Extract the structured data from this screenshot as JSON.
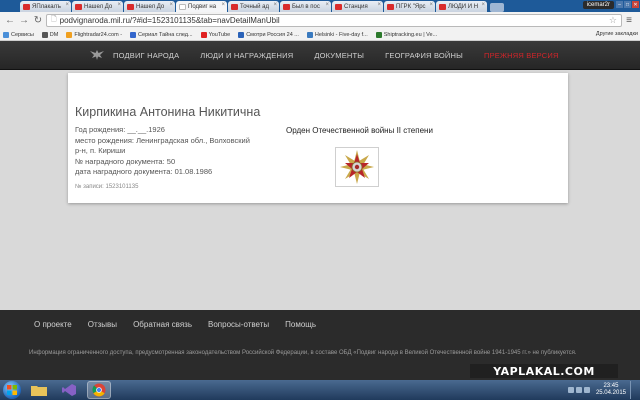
{
  "browser": {
    "tabs": [
      {
        "label": "ЯПлакалъ",
        "favicon": "red",
        "active": false
      },
      {
        "label": "Нашел До",
        "favicon": "red",
        "active": false
      },
      {
        "label": "Нашел До",
        "favicon": "red",
        "active": false
      },
      {
        "label": "Подвиг на",
        "favicon": "white",
        "active": true
      },
      {
        "label": "Точный ад",
        "favicon": "red",
        "active": false
      },
      {
        "label": "Был в пос",
        "favicon": "red",
        "active": false
      },
      {
        "label": "Станция",
        "favicon": "red",
        "active": false
      },
      {
        "label": "ПГРК \"Ярс",
        "favicon": "red",
        "active": false
      },
      {
        "label": "ЛЮДИ И Н",
        "favicon": "red",
        "active": false
      }
    ],
    "user": "icemar2r",
    "url": "podvignaroda.mil.ru/?#id=1523101135&tab=navDetailManUbil",
    "bookmarks": [
      {
        "label": "Сервисы",
        "color": "#4a8fd8"
      },
      {
        "label": "DM",
        "color": "#555555"
      },
      {
        "label": "Flightradar24.com -",
        "color": "#f0a020"
      },
      {
        "label": "Сериал Тайна след...",
        "color": "#3366cc"
      },
      {
        "label": "YouTube",
        "color": "#e02020"
      },
      {
        "label": "Смотри Россия 24 ...",
        "color": "#2a62b8"
      },
      {
        "label": "Helsinki - Five-day f...",
        "color": "#3a7abf"
      },
      {
        "label": "Shiptracking.eu | Ve...",
        "color": "#2c7a2c"
      }
    ],
    "other_bookmarks": "Другие закладки"
  },
  "site": {
    "nav": [
      {
        "label": "ПОДВИГ НАРОДА",
        "accent": false
      },
      {
        "label": "ЛЮДИ И НАГРАЖДЕНИЯ",
        "accent": false
      },
      {
        "label": "ДОКУМЕНТЫ",
        "accent": false
      },
      {
        "label": "ГЕОГРАФИЯ ВОЙНЫ",
        "accent": false
      },
      {
        "label": "ПРЕЖНЯЯ ВЕРСИЯ",
        "accent": true
      }
    ],
    "accent_color": "#d0252a"
  },
  "record": {
    "name": "Кирпикина Антонина Никитична",
    "details": [
      "Год рождения: __.__.1926",
      "место рождения: Ленинградская обл., Волховский",
      "р-н, п. Кириши",
      "№ наградного документа: 50",
      "дата наградного документа: 01.08.1986"
    ],
    "record_id": "№ записи: 1523101135",
    "award": "Орден Отечественной войны II степени"
  },
  "footer": {
    "links": [
      "О проекте",
      "Отзывы",
      "Обратная связь",
      "Вопросы-ответы",
      "Помощь"
    ],
    "note": "Информация ограниченного доступа, предусмотренная законодательством Российской Федерации, в составе ОБД «Подвиг народа в Великой Отечественной войне 1941-1945 гг.» не публикуется."
  },
  "taskbar": {
    "time": "23:45",
    "date": "25.04.2015"
  },
  "watermark": "YAPLAKAL.COM"
}
